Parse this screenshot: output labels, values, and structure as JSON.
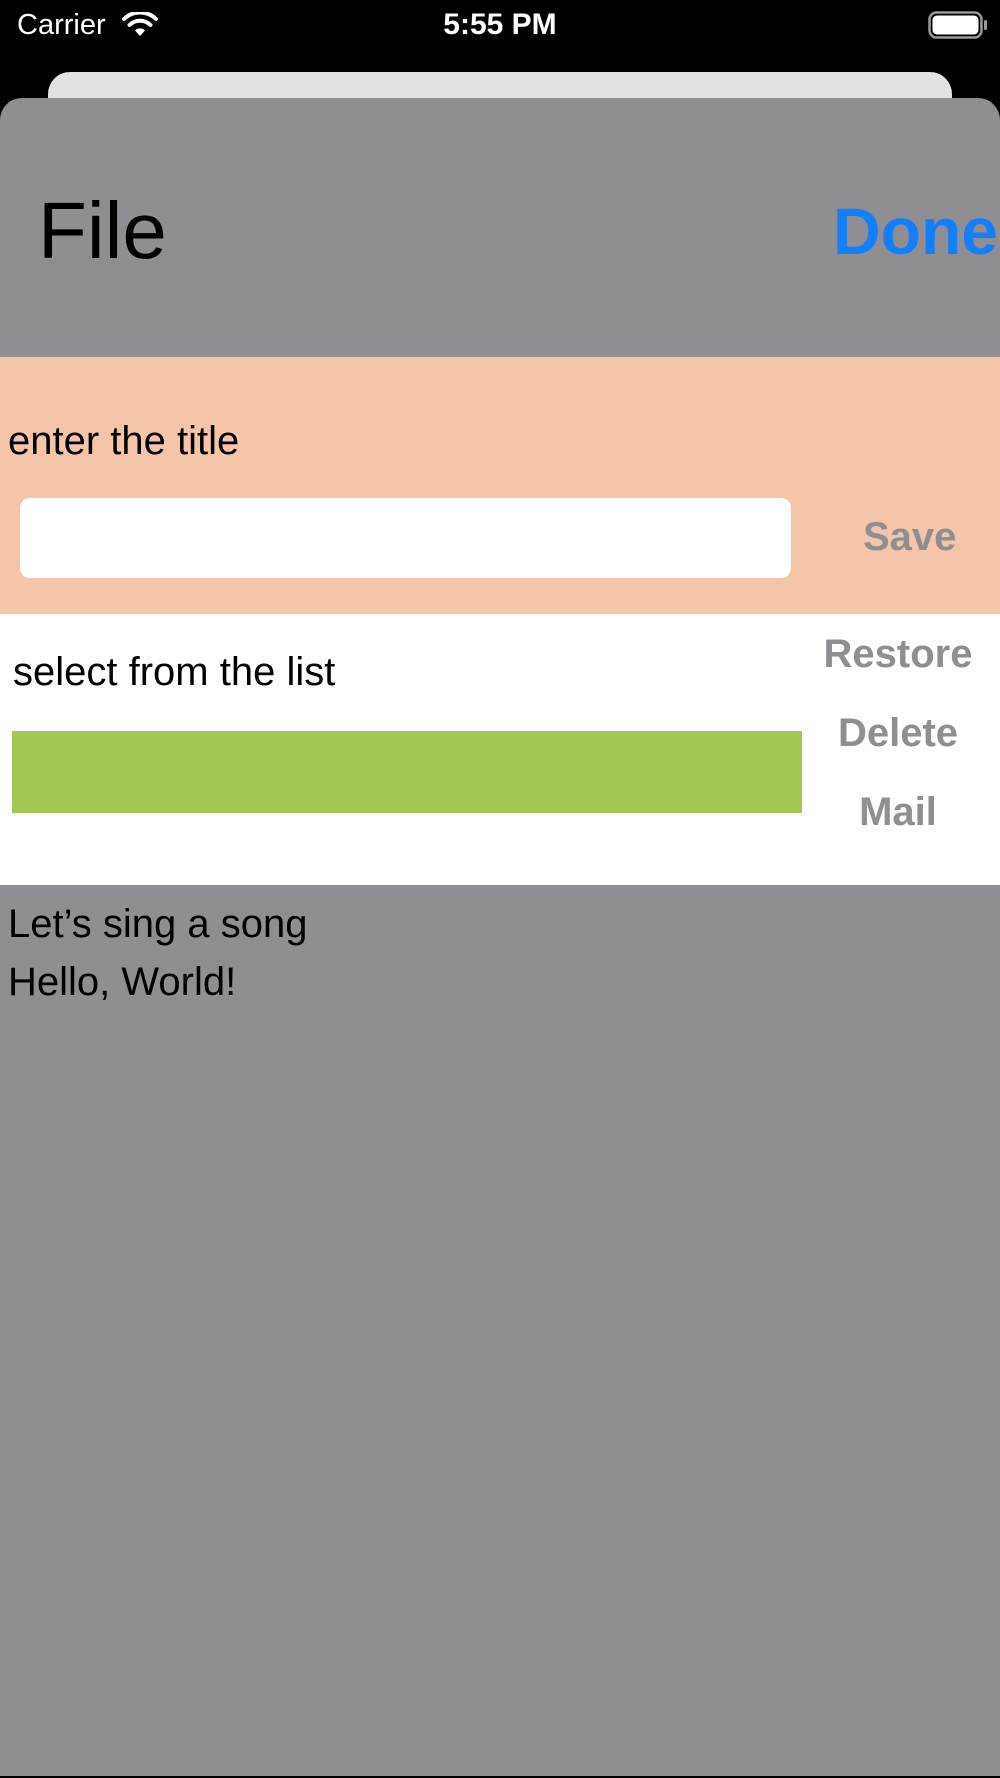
{
  "status_bar": {
    "carrier": "Carrier",
    "time": "5:55 PM",
    "wifi_icon": "wifi-icon",
    "battery_icon": "battery-full-icon"
  },
  "nav": {
    "title": "File",
    "done_label": "Done"
  },
  "title_section": {
    "label": "enter the title",
    "input_value": "",
    "save_label": "Save"
  },
  "list_section": {
    "label": "select from the list",
    "actions": {
      "restore": "Restore",
      "delete": "Delete",
      "mail": "Mail"
    }
  },
  "content": {
    "lines": [
      "Let’s sing a song",
      "Hello, World!"
    ]
  },
  "colors": {
    "status_bar_bg": "#000000",
    "sheet_bg": "#8f8e93",
    "title_panel_bg": "#f5c5aa",
    "list_panel_bg": "#ffffff",
    "picker_fill": "#a2c854",
    "accent": "#147efb",
    "disabled_text": "#8e8e93"
  }
}
